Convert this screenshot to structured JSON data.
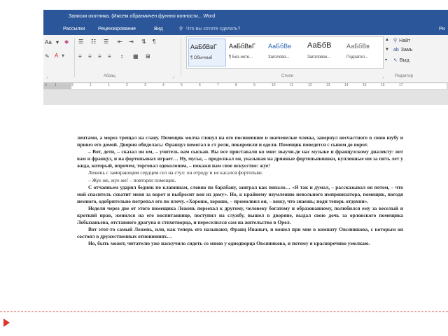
{
  "window": {
    "title": "Записки охотника. (Ижсем обраниичен фуннно ионности... Word"
  },
  "menu": {
    "tabs": [
      "Рассылки",
      "Рецензирование",
      "Вид"
    ],
    "tell_me": "Что вы хотите сделать?",
    "right_cut": "Ри"
  },
  "ribbon": {
    "font_size_label": "Aa",
    "groups": {
      "paragraph": "Абзац",
      "styles": "Стили",
      "editing": "Редактир"
    },
    "styles": [
      {
        "sample": "АаБбВвГ",
        "name": "¶ Обычный"
      },
      {
        "sample": "АаБбВвГ",
        "name": "¶ Без инте..."
      },
      {
        "sample": "АаБбВв",
        "name": "Заголово..."
      },
      {
        "sample": "АаБбВ",
        "name": "Заголовок..."
      },
      {
        "sample": "АаБбВв",
        "name": "Подзагол..."
      }
    ],
    "editing": {
      "find": "Найт",
      "replace": "Замь",
      "select": "Выд"
    }
  },
  "ruler": {
    "ticks": [
      "3",
      "1",
      "2",
      "1",
      "1",
      "2",
      "3",
      "4",
      "5",
      "6",
      "7",
      "8",
      "9",
      "10",
      "11",
      "12",
      "13",
      "14",
      "15",
      "16",
      "17"
    ]
  },
  "document": {
    "paragraphs": [
      "лентами, а мороз трещал на славу. Помещик молча глянул на его посиневшие и окоченелые члены, завернул несчастного в свою шубу и привез его домой. Дворня обиделась: Француз помогал в ст рели, покормили и одели. Помещик поведется с сыном до ворот.",
      "– Вот, дети, – сказал он им, – учитель вам сыскан. Вы все приставали ко мне: выучи-де нас музыке и французскому диалекту: вот вам и француз, и на фортопьянах играет… Ну, мусье, – продолжал он, указывая на дрянные фортопьянишки, купленные им за пять лет у жида, который, впрочем, торговал одеколоном, – покажи нам свое искусство: жуе!",
      "Лежень с замирающим сердцем сел на стул: он отроду и не касался фортопьян.",
      "– Жуе же, жуе же! – повторял помещик.",
      "С отчаяньем ударил бедняк по клавишам, словно по барабану, заиграл как попало… «Я так и думал, – рассказывал он потом, – что мой спаситель схватит меня за ворот и выбросит вон из дому». Но, к крайнему изумлению невольного импровизатора, помещик, погодя немного, одобрительно потрепал его по плечу. «Хорошо, хорошо, – промолвил он, – вижу, что знаешь; поди теперь отдохни».",
      "Недели через две от этого помещика Лежень переехал к другому, человеку богатому и образованному, полюбился ему за веселый и кроткий нрав, женился на его воспитаннице, поступил на службу, вышел в дворяне, выдал свою дочь за орловского помещика Лобызаньева, отставного драгуна и стихотворца, и переселился сам на жительство в Орел.",
      "Вот этот-то самый Лежень, или, как теперь его называют, Франц Иваныч, и вошел при мне в комнату Овсяникова, с которым он состоял в дружественных отношениях…",
      "Но, быть может, читателю уже наскучило сидеть со мною у однодворца Овсяникова, и потому я красноречиво умолкаю."
    ]
  }
}
